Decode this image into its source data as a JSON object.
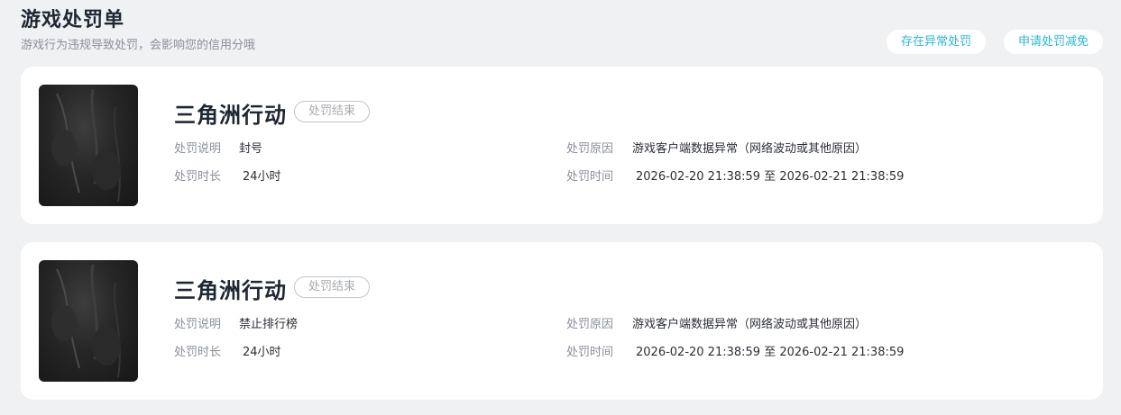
{
  "header": {
    "title": "游戏处罚单",
    "subtitle": "游戏行为违规导致处罚，会影响您的信用分哦"
  },
  "actions": {
    "abnormal_label": "存在异常处罚",
    "reduce_label": "申请处罚减免"
  },
  "labels": {
    "description": "处罚说明",
    "duration": "处罚时长",
    "reason": "处罚原因",
    "time": "处罚时间"
  },
  "records": [
    {
      "game": "三角洲行动",
      "status": "处罚结束",
      "description": "封号",
      "duration": "24小时",
      "reason": "游戏客户端数据异常（网络波动或其他原因）",
      "time": "2026-02-20 21:38:59 至 2026-02-21 21:38:59"
    },
    {
      "game": "三角洲行动",
      "status": "处罚结束",
      "description": "禁止排行榜",
      "duration": "24小时",
      "reason": "游戏客户端数据异常（网络波动或其他原因）",
      "time": "2026-02-20 21:38:59 至 2026-02-21 21:38:59"
    }
  ],
  "colors": {
    "accent": "#2bb7d6",
    "background": "#f0f1f3",
    "card": "#ffffff"
  }
}
